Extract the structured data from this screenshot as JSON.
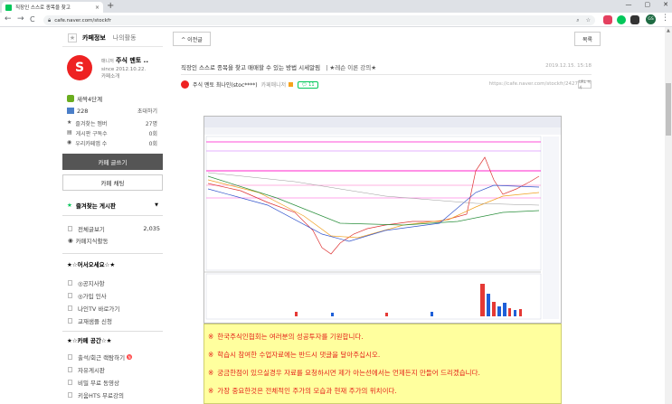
{
  "browser": {
    "tab_title": "직장인 스스로 종목을 찾고",
    "tab_close": "×",
    "new_tab": "+",
    "url": "cafe.naver.com/stockfr",
    "win_min": "—",
    "win_max": "▢",
    "win_close": "✕",
    "back": "←",
    "forward": "→",
    "reload": "C",
    "profile_initials": "GS"
  },
  "sidebar": {
    "tab_cafe_info": "카페정보",
    "tab_my_activity": "나의활동",
    "manager_label": "매니저",
    "cafe_name": "주식 멘토 ..",
    "since": "since 2012.10.22.",
    "intro": "카페소개",
    "rank": "새싹4단계",
    "members": "228",
    "invite": "초대하기",
    "stats": [
      {
        "label": "즐겨찾는 멤버",
        "value": "27명"
      },
      {
        "label": "게시판 구독수",
        "value": "0회"
      },
      {
        "label": "우리카페앱 수",
        "value": "0회"
      }
    ],
    "write_button": "카페 글쓰기",
    "chat_button": "카페 채팅",
    "fav_boards_title": "즐겨찾는 게시판",
    "all_posts_label": "전체글보기",
    "all_posts_count": "2,035",
    "knowledge": "카페지식활동",
    "section1_title": "★☆어서오세요☆★",
    "section1_items": [
      "◎공지사항",
      "◎가입 인사",
      "나인TV 바로가기",
      "교재샘플 신청"
    ],
    "section2_title": "★☆카페 공간☆★",
    "section2_items": [
      "출석/회근 랙탐하기",
      "자유게시판",
      "비밀 무료 동영상",
      "키움HTS 무료강의",
      "..."
    ]
  },
  "main": {
    "prev_button": "^ 이전글",
    "list_button": "목록",
    "post_title": "직장인 스스로 종목을 찾고 매매할 수 있는 방법 시세알림",
    "post_category": "| ★레슨 이론 강의★",
    "post_date": "2019.12.15. 15:18",
    "author_name": "주식 멘토 최나인(stoc****)",
    "author_alias": "카페매니저",
    "comments": "11",
    "post_url": "https://cafe.naver.com/stockfr/2427",
    "copy_url": "URL 복사",
    "notice_mark": "※",
    "notice_lines": [
      "한국주식인협회는 여러분의 성공투자를 기원합니다.",
      "학습시 참여한 수업자료에는 반드시 댓글을 달아주십시오.",
      "궁금한점이 있으실경우 자료를 요청하시면 제가 아는선에서는 언제든지 만들어 드리겠습니다.",
      "가장 중요한것은 전체적인 주가의 모습과 현재 주가의 위치이다."
    ]
  },
  "colors": {
    "naver_green": "#03c75a",
    "notice_bg": "#ffff9e",
    "notice_text": "#e5231b",
    "dark_button": "#555555"
  }
}
